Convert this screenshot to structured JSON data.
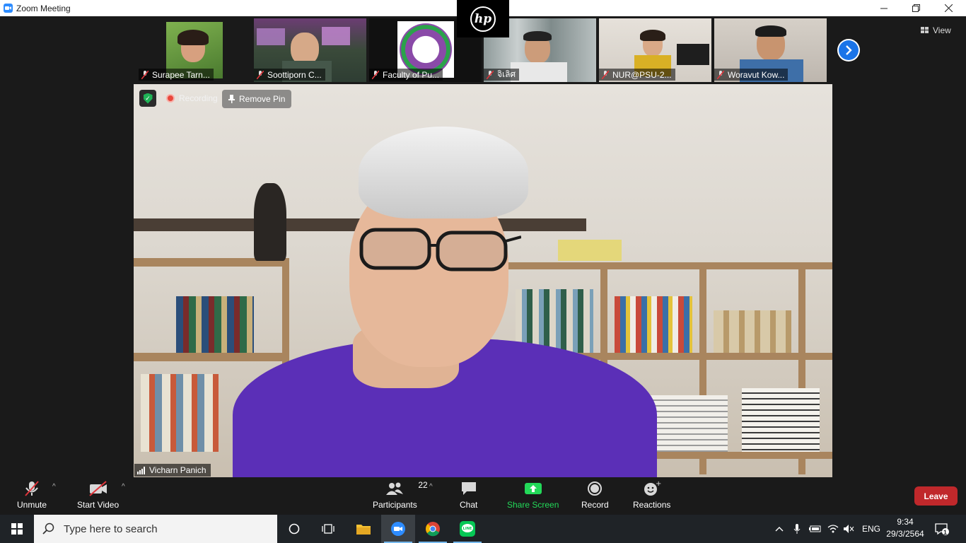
{
  "window": {
    "title": "Zoom Meeting",
    "controls": {
      "minimize": "—",
      "restore": "❐",
      "close": "✕"
    }
  },
  "overlay_logo": {
    "text": "hp"
  },
  "gallery": {
    "participants": [
      {
        "name": "Surapee Tarn...",
        "muted": true,
        "bg": "#5b8a3a"
      },
      {
        "name": "Soottiporn C...",
        "muted": true,
        "bg": "#3a4a3a"
      },
      {
        "name": "Faculty of Pu...",
        "muted": true,
        "bg": "#111111"
      },
      {
        "name": "จิเลิศ",
        "muted": true,
        "bg": "#7c8a8a"
      },
      {
        "name": "NUR@PSU-2...",
        "muted": true,
        "bg": "#c9c4bc"
      },
      {
        "name": "Woravut Kow...",
        "muted": true,
        "bg": "#b8b3ad"
      }
    ],
    "next_icon": "chevron-right-icon",
    "view_label": "View"
  },
  "main_video": {
    "recording_label": "Recording",
    "remove_pin_label": "Remove Pin",
    "speaker_name": "Vicharn Panich",
    "shirt_color": "#5b2fb7"
  },
  "toolbar": {
    "unmute": "Unmute",
    "start_video": "Start Video",
    "participants": "Participants",
    "participant_count": "22",
    "chat": "Chat",
    "share_screen": "Share Screen",
    "record": "Record",
    "reactions": "Reactions",
    "leave": "Leave",
    "share_color": "#23d959",
    "leave_color": "#c0282b"
  },
  "taskbar": {
    "search_placeholder": "Type here to search",
    "language": "ENG",
    "time": "9:34",
    "date": "29/3/2564",
    "notification_count": "1"
  }
}
